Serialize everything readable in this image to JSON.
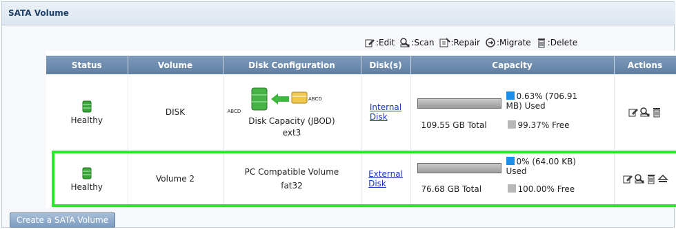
{
  "panel": {
    "title": "SATA Volume"
  },
  "legend": [
    {
      "icon": "edit-icon",
      "label": ":Edit"
    },
    {
      "icon": "scan-icon",
      "label": ":Scan"
    },
    {
      "icon": "repair-icon",
      "label": ":Repair"
    },
    {
      "icon": "migrate-icon",
      "label": ":Migrate"
    },
    {
      "icon": "delete-icon",
      "label": ":Delete"
    }
  ],
  "table": {
    "columns": [
      "Status",
      "Volume",
      "Disk Configuration",
      "Disk(s)",
      "Capacity",
      "Actions"
    ],
    "rows": [
      {
        "status": "Healthy",
        "volume": "DISK",
        "config_line1": "Disk Capacity (JBOD)",
        "config_line2": "ext3",
        "config_icon_label_a": "ABCD",
        "config_icon_label_b": "ABCD",
        "disk_line1": "Internal",
        "disk_line2": "Disk",
        "used_text": "0.63% (706.91 MB) Used",
        "used_fraction": 0.0063,
        "total_text": "109.55 GB Total",
        "free_text": "99.37% Free"
      },
      {
        "status": "Healthy",
        "volume": "Volume 2",
        "config_line1": "PC Compatible Volume",
        "config_line2": "fat32",
        "disk_line1": "External",
        "disk_line2": "Disk",
        "used_text": "0% (64.00 KB) Used",
        "used_fraction": 0,
        "total_text": "76.68 GB Total",
        "free_text": "100.00% Free"
      }
    ]
  },
  "create_button": "Create a SATA Volume",
  "colors": {
    "header": "#6f8eb1",
    "highlight": "#2ee62e",
    "used": "#1e8fe8",
    "free": "#b8b8b8",
    "link": "#1b37c9"
  }
}
